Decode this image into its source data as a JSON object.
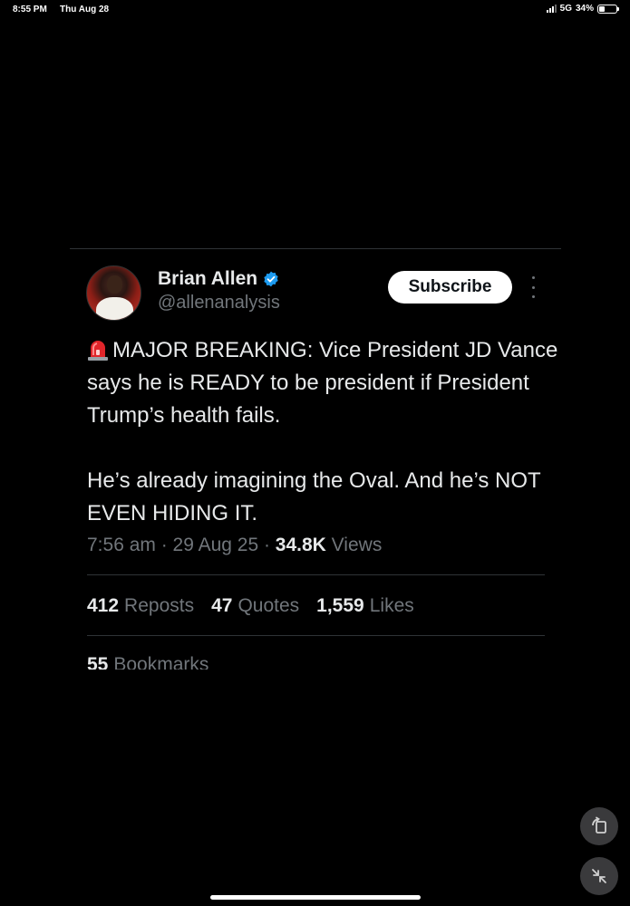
{
  "status_bar": {
    "time": "8:55 PM",
    "date": "Thu Aug 28",
    "network": "5G",
    "battery": "34%",
    "battery_level": 0.34
  },
  "tweet": {
    "author_name": "Brian Allen",
    "handle": "@allenanalysis",
    "subscribe_label": "Subscribe",
    "body_paragraph_1": "MAJOR BREAKING: Vice President JD Vance says he is READY to be president if President Trump’s health fails.",
    "body_paragraph_2": "He’s already imagining the Oval. And he’s NOT EVEN HIDING IT.",
    "time_date": "7:56 am · 29 Aug 25 · ",
    "views_count": "34.8K",
    "views_label": " Views",
    "reposts_count": "412",
    "reposts_label": "Reposts",
    "quotes_count": "47",
    "quotes_label": "Quotes",
    "likes_count": "1,559",
    "likes_label": "Likes",
    "bookmarks_count": "55",
    "bookmarks_label": "Bookmarks"
  },
  "colors": {
    "background": "#000000",
    "text_primary": "#e7e9ea",
    "text_secondary": "#71767b",
    "verified_blue": "#1d9bf0",
    "divider": "#2f3336"
  },
  "icons": {
    "verified": "verified-badge-icon",
    "siren": "police-siren-emoji-icon",
    "more": "more-vertical-icon",
    "rotate": "rotate-screen-icon",
    "collapse": "collapse-arrows-icon"
  }
}
